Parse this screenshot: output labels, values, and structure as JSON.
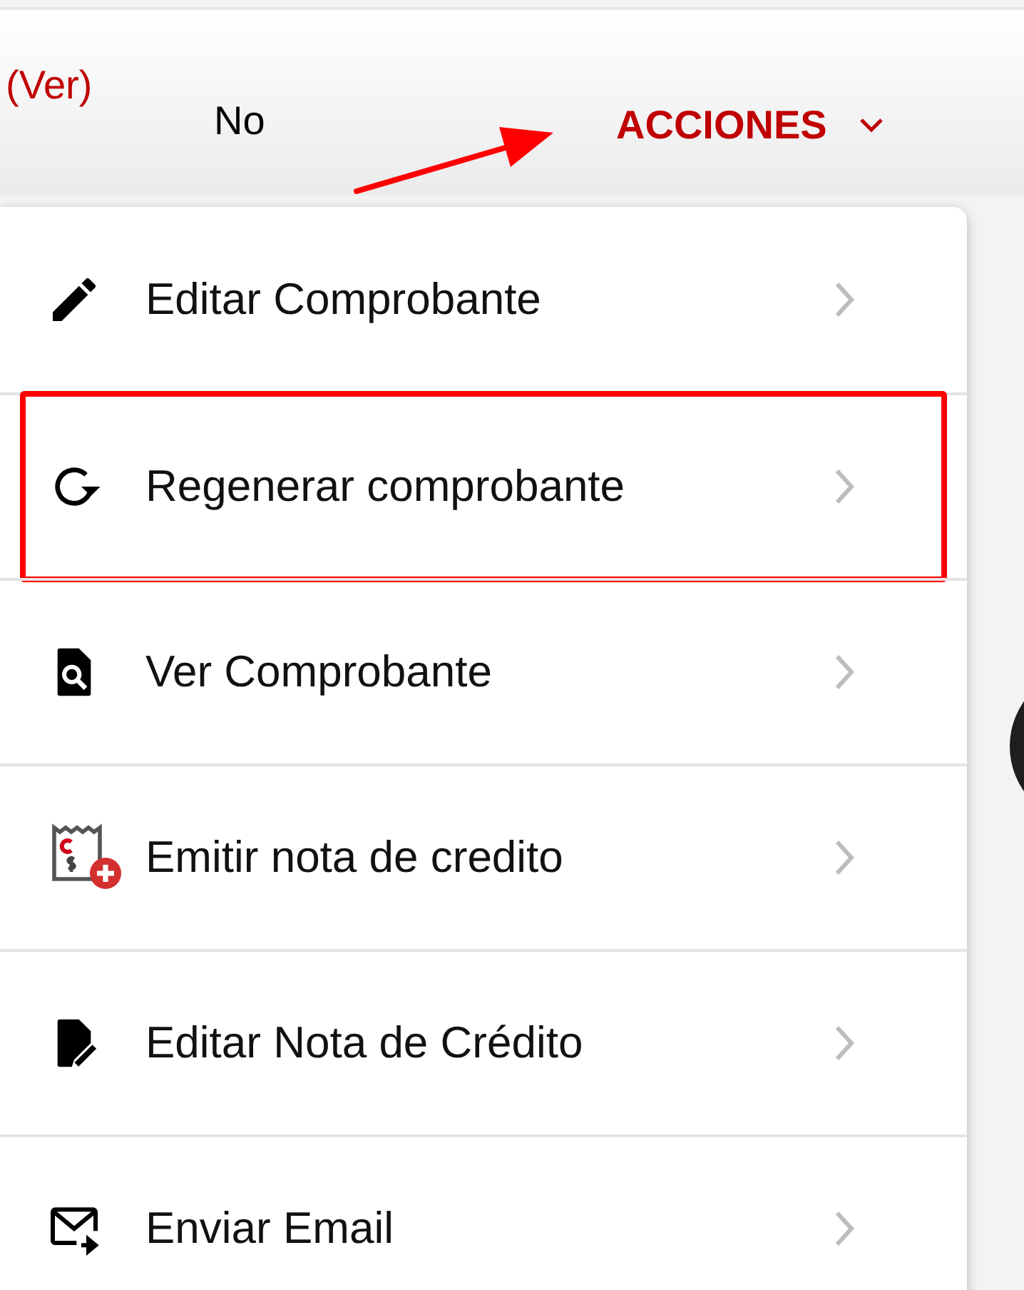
{
  "row": {
    "link": "(Ver)",
    "value": "No",
    "actions_button": "ACCIONES"
  },
  "menu": {
    "items": [
      {
        "label": "Editar Comprobante",
        "kind": "pencil",
        "highlighted": false
      },
      {
        "label": "Regenerar comprobante",
        "kind": "refresh",
        "highlighted": true
      },
      {
        "label": "Ver Comprobante",
        "kind": "search-file",
        "highlighted": false
      },
      {
        "label": "Emitir nota de credito",
        "kind": "receipt",
        "highlighted": false
      },
      {
        "label": "Editar Nota de Crédito",
        "kind": "edit-file",
        "highlighted": false
      },
      {
        "label": "Enviar Email",
        "kind": "mail",
        "highlighted": false
      }
    ]
  }
}
